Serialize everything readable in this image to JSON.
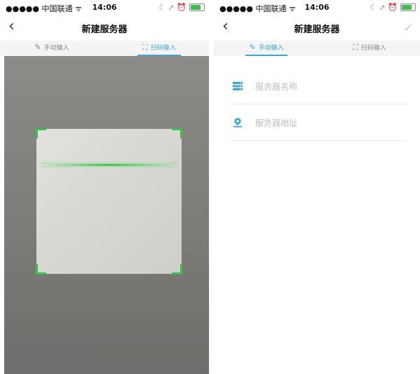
{
  "status_bar": {
    "carrier": "●●●●● 中国联通",
    "wifi_icon": "wifi-icon",
    "time": "14:06",
    "indicators": "☾ ➚ ⏰"
  },
  "left_screen": {
    "title": "新建服务器",
    "tabs": [
      {
        "label": "手动输入",
        "icon": "edit-icon",
        "active": false
      },
      {
        "label": "扫码输入",
        "icon": "scan-icon",
        "active": true
      }
    ]
  },
  "right_screen": {
    "title": "新建服务器",
    "tabs": [
      {
        "label": "手动输入",
        "icon": "edit-icon",
        "active": true
      },
      {
        "label": "扫码输入",
        "icon": "scan-icon",
        "active": false
      }
    ],
    "fields": [
      {
        "placeholder": "服务器名称",
        "icon": "server-icon"
      },
      {
        "placeholder": "服务器地址",
        "icon": "location-pin-icon"
      }
    ]
  },
  "colors": {
    "accent": "#3aa7d8",
    "scan_green": "#34c24b",
    "battery_green": "#3cc04a"
  }
}
